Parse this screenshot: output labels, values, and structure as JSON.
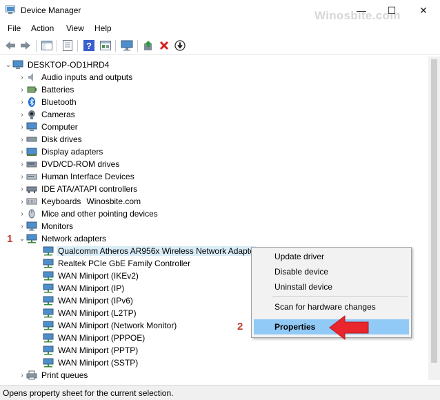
{
  "window": {
    "title": "Device Manager",
    "watermark": "Winosbite.com",
    "minimize_glyph": "—",
    "maximize_glyph": "☐",
    "close_glyph": "✕"
  },
  "menu": [
    "File",
    "Action",
    "View",
    "Help"
  ],
  "toolbar_icons": [
    "back-icon",
    "forward-icon",
    "show-hide-console-tree-icon",
    "properties-sheet-icon",
    "help-icon",
    "view-icon",
    "monitor-icon",
    "update-driver-icon",
    "uninstall-icon",
    "download-icon"
  ],
  "tree": {
    "root": "DESKTOP-OD1HRD4",
    "categories": [
      {
        "label": "Audio inputs and outputs",
        "icon": "speaker-icon"
      },
      {
        "label": "Batteries",
        "icon": "battery-icon"
      },
      {
        "label": "Bluetooth",
        "icon": "bluetooth-icon"
      },
      {
        "label": "Cameras",
        "icon": "camera-icon"
      },
      {
        "label": "Computer",
        "icon": "computer-icon"
      },
      {
        "label": "Disk drives",
        "icon": "disk-drive-icon"
      },
      {
        "label": "Display adapters",
        "icon": "display-adapter-icon"
      },
      {
        "label": "DVD/CD-ROM drives",
        "icon": "dvd-icon"
      },
      {
        "label": "Human Interface Devices",
        "icon": "hid-icon"
      },
      {
        "label": "IDE ATA/ATAPI controllers",
        "icon": "ide-controller-icon"
      },
      {
        "label": "Keyboards",
        "icon": "keyboard-icon"
      },
      {
        "label": "Mice and other pointing devices",
        "icon": "mouse-icon"
      },
      {
        "label": "Monitors",
        "icon": "monitor-icon"
      },
      {
        "label": "Network adapters",
        "icon": "network-adapter-icon"
      }
    ],
    "keyboards_watermark": "Winosbite.com",
    "network_adapters": [
      "Qualcomm Atheros AR956x Wireless Network Adapte",
      "Realtek PCIe GbE Family Controller",
      "WAN Miniport (IKEv2)",
      "WAN Miniport (IP)",
      "WAN Miniport (IPv6)",
      "WAN Miniport (L2TP)",
      "WAN Miniport (Network Monitor)",
      "WAN Miniport (PPPOE)",
      "WAN Miniport (PPTP)",
      "WAN Miniport (SSTP)"
    ],
    "after": "Print queues"
  },
  "context_menu": {
    "items": [
      "Update driver",
      "Disable device",
      "Uninstall device"
    ],
    "scan": "Scan for hardware changes",
    "properties": "Properties"
  },
  "markers": {
    "step1": "1",
    "step2": "2"
  },
  "status": "Opens property sheet for the current selection.",
  "colors": {
    "selection": "#d9ecf7",
    "menu_highlight": "#91c9f7",
    "marker": "#c0392b",
    "arrow": "#e8262b"
  }
}
